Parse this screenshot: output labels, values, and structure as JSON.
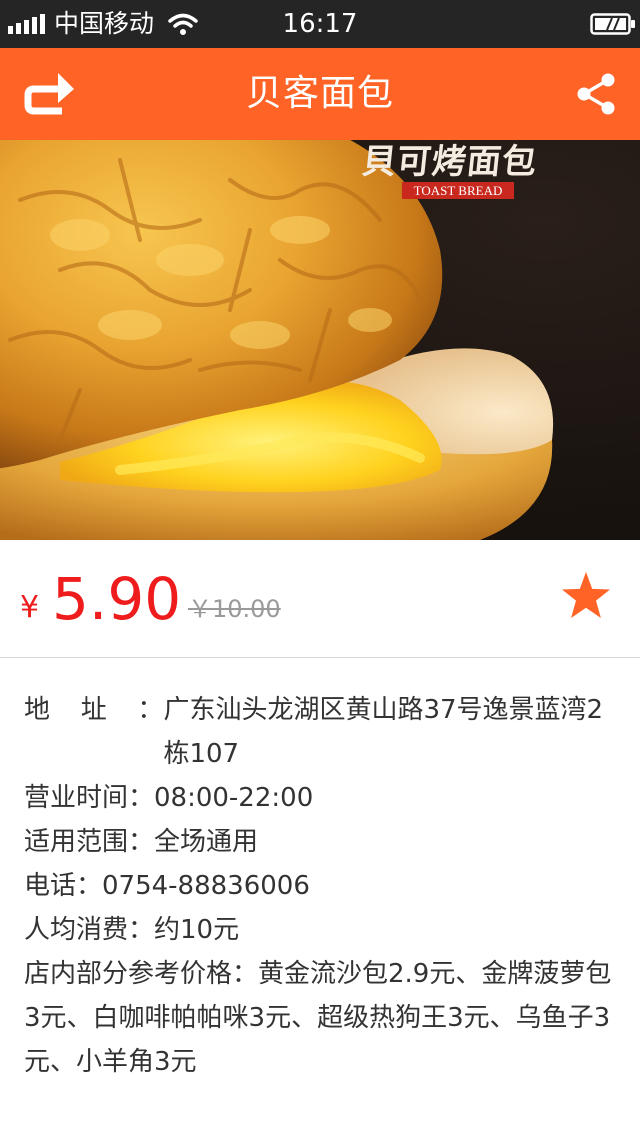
{
  "status_bar": {
    "carrier": "中国移动",
    "time": "16:17"
  },
  "nav": {
    "title": "贝客面包",
    "back_icon": "back-arrow-icon",
    "share_icon": "share-icon"
  },
  "hero": {
    "brand_title": "貝可烤面包",
    "brand_tag": "TOAST BREAD"
  },
  "price": {
    "currency": "¥",
    "current": "5.90",
    "original": "￥10.00",
    "favorite_icon": "star-icon",
    "accent_color": "#ff6326",
    "price_color": "#ee1c1c"
  },
  "info": {
    "address_label": "地址：",
    "address": "广东汕头龙湖区黄山路37号逸景蓝湾2栋107",
    "hours": "营业时间：08:00-22:00",
    "scope": "适用范围：全场通用",
    "phone": "电话：0754-88836006",
    "avg_spend": "人均消费：约10元",
    "reference_prices": "店内部分参考价格：黄金流沙包2.9元、金牌菠萝包3元、白咖啡帕帕咪3元、超级热狗王3元、乌鱼子3元、小羊角3元"
  }
}
